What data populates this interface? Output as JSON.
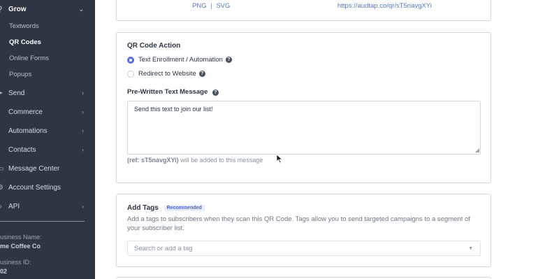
{
  "sidebar": {
    "grow": {
      "label": "Grow"
    },
    "sub_items": [
      {
        "label": "Textwords"
      },
      {
        "label": "QR Codes"
      },
      {
        "label": "Online Forms"
      },
      {
        "label": "Popups"
      }
    ],
    "nav_items": [
      {
        "label": "Send",
        "icon": "send-icon"
      },
      {
        "label": "Commerce",
        "icon": "cart-icon"
      },
      {
        "label": "Automations",
        "icon": "automation-icon"
      },
      {
        "label": "Contacts",
        "icon": "contacts-icon"
      },
      {
        "label": "Message Center",
        "icon": "message-icon"
      },
      {
        "label": "Account Settings",
        "icon": "gear-icon"
      },
      {
        "label": "API",
        "icon": "code-icon"
      }
    ],
    "business_name_label": "usiness Name:",
    "business_name": "me Coffee Co",
    "business_id_label": "usiness ID:",
    "business_id": "02"
  },
  "top_card": {
    "png": "PNG",
    "svg": "SVG",
    "separator": "|",
    "url": "https://audtap.co/qr/sT5navgXYi"
  },
  "action": {
    "title": "QR Code Action",
    "option_text": "Text Enrollment / Automation",
    "option_redirect": "Redirect to Website",
    "message_label": "Pre-Written Text Message",
    "message_value": "Send this text to join our list!",
    "ref_code": "(ref: sT5navgXYi)",
    "ref_suffix": "will be added to this message"
  },
  "tags": {
    "title": "Add Tags",
    "badge": "Recommended",
    "description": "Add a tags to subscribers when they scan this QR Code. Tags allow you to send targeted campaigns to a segment of your subscriber list.",
    "placeholder": "Search or add a tag"
  },
  "colors": {
    "sidebar_bg": "#2d3643",
    "accent": "#5a6fd6",
    "link": "#5b79b8"
  }
}
